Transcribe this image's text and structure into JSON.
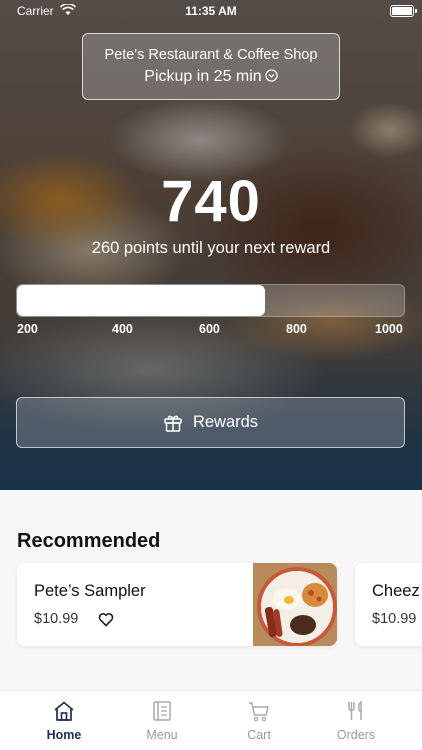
{
  "status_bar": {
    "carrier": "Carrier",
    "time": "11:35 AM"
  },
  "restaurant": {
    "name": "Pete's Restaurant & Coffee Shop",
    "pickup": "Pickup in 25 min"
  },
  "loyalty": {
    "points": "740",
    "caption": "260 points until your next reward",
    "progress_fraction": 0.64,
    "ticks": [
      "200",
      "400",
      "600",
      "800",
      "1000"
    ],
    "rewards_label": "Rewards"
  },
  "recommended": {
    "title": "Recommended",
    "items": [
      {
        "name": "Pete’s Sampler",
        "price": "$10.99"
      },
      {
        "name": "Cheez",
        "price": "$10.99"
      }
    ]
  },
  "tabs": [
    {
      "label": "Home",
      "icon": "home-icon",
      "active": true
    },
    {
      "label": "Menu",
      "icon": "menu-icon",
      "active": false
    },
    {
      "label": "Cart",
      "icon": "cart-icon",
      "active": false
    },
    {
      "label": "Orders",
      "icon": "orders-icon",
      "active": false
    }
  ],
  "colors": {
    "accent": "#1e2d5a",
    "inactive": "#999999"
  }
}
